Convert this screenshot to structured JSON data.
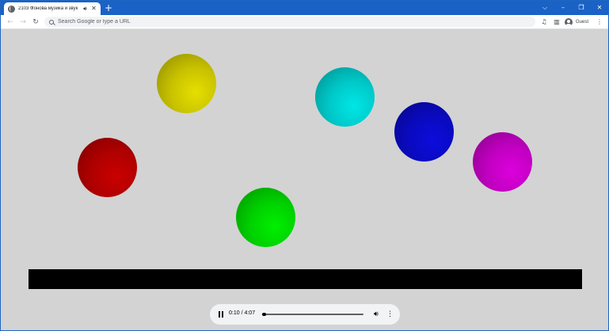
{
  "tab": {
    "title": "2103 Фонова музика и звук",
    "audio_icon": "speaker-icon",
    "close_symbol": "✕"
  },
  "toolbar": {
    "omnibox_placeholder": "Search Google or type a URL",
    "profile_label": "Guest"
  },
  "player": {
    "time": "0:10 / 4:07",
    "progress_fraction": 0.04
  },
  "balls": [
    {
      "name": "ball-yellow",
      "color": "#c8c200"
    },
    {
      "name": "ball-cyan",
      "color": "#00c8c8"
    },
    {
      "name": "ball-blue",
      "color": "#0a0ac0"
    },
    {
      "name": "ball-red",
      "color": "#b00000"
    },
    {
      "name": "ball-magenta",
      "color": "#c000c0"
    },
    {
      "name": "ball-green",
      "color": "#00d000"
    }
  ],
  "colors": {
    "chrome_blue": "#1a62c5",
    "background": "#d3d3d3",
    "bar": "#000000"
  }
}
